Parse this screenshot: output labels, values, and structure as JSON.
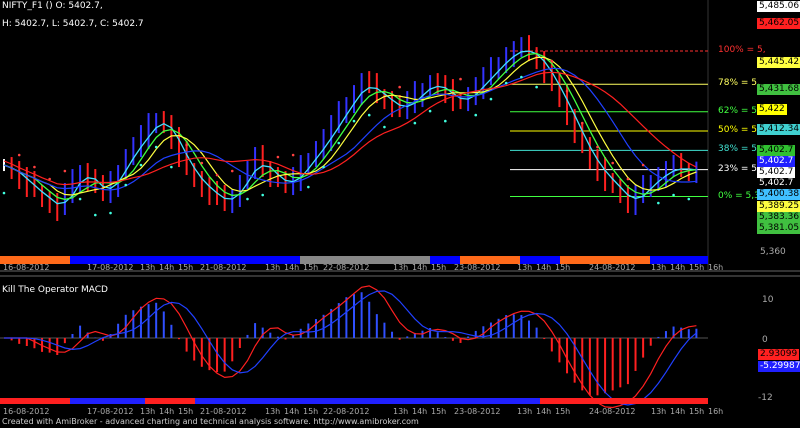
{
  "main_title": "NIFTY_F1 () O: 5402.7,",
  "main_ohlc": "H: 5402.7, L: 5402.7, C: 5402.7",
  "macd_title": "Kill The Operator MACD",
  "footer": "Created with AmiBroker - advanced charting and technical analysis software. http://www.amibroker.com",
  "colors": {
    "background": "#000000",
    "up_bar": "#3333ff",
    "down_bar": "#ff2020",
    "neutral_bar": "#ffffff",
    "ribbon_up": "#0000ff",
    "ribbon_down": "#ff6a1a",
    "ribbon_neutral": "#888888"
  },
  "fib_levels": [
    {
      "text": "100% = 5,",
      "price": 5462.05,
      "color": "#ff3030"
    },
    {
      "text": "78% = 5,",
      "price": 5445.42,
      "color": "#ffff60"
    },
    {
      "text": "62% = 5,",
      "price": 5431.68,
      "color": "#40ff40"
    },
    {
      "text": "50% = 5,",
      "price": 5422,
      "color": "#ffff00"
    },
    {
      "text": "38% = 5,",
      "price": 5412.34,
      "color": "#40e0d0"
    },
    {
      "text": "23% = 5,",
      "price": 5402.7,
      "color": "#ffffff"
    },
    {
      "text": "0% = 5,3",
      "price": 5389.25,
      "color": "#40ff40"
    }
  ],
  "price_labels": [
    {
      "text": "5,485.06",
      "bg": "#ffffff",
      "fg": "#000000"
    },
    {
      "text": "5,462.05",
      "bg": "#ff2020",
      "fg": "#000000"
    },
    {
      "text": "5,445.42",
      "bg": "#ffff40",
      "fg": "#000000"
    },
    {
      "text": "5,431.68",
      "bg": "#40c040",
      "fg": "#000000"
    },
    {
      "text": "5,422",
      "bg": "#ffff00",
      "fg": "#000000"
    },
    {
      "text": "5,412.34",
      "bg": "#40d0d0",
      "fg": "#000000"
    },
    {
      "text": "5,402.7",
      "bg": "#30c030",
      "fg": "#000000"
    },
    {
      "text": "5,402.7",
      "bg": "#2020ff",
      "fg": "#ffffff"
    },
    {
      "text": "5,402.7",
      "bg": "#ffffff",
      "fg": "#000000"
    },
    {
      "text": "5,402.7",
      "bg": "#000000",
      "fg": "#ffffff"
    },
    {
      "text": "5,400.38",
      "bg": "#40c0ff",
      "fg": "#000000"
    },
    {
      "text": "5,389.25",
      "bg": "#ffff40",
      "fg": "#000000"
    },
    {
      "text": "5,383.36",
      "bg": "#40c040",
      "fg": "#000000"
    },
    {
      "text": "5,381.05",
      "bg": "#40c040",
      "fg": "#000000"
    }
  ],
  "main_axis_ticks": [
    "5,360"
  ],
  "macd_labels": [
    {
      "text": "2.93099",
      "bg": "#ff2020",
      "fg": "#000000"
    },
    {
      "text": "-5.29987",
      "bg": "#2020ff",
      "fg": "#ffffff"
    }
  ],
  "macd_axis_ticks": [
    "10",
    "0",
    "-12"
  ],
  "time_labels": [
    "16-08-2012",
    "17-08-2012",
    "13h",
    "14h",
    "15h",
    "21-08-2012",
    "13h",
    "14h",
    "15h",
    "22-08-2012",
    "13h",
    "14h",
    "15h",
    "23-08-2012",
    "13h",
    "14h",
    "15h",
    "24-08-2012",
    "13h",
    "14h",
    "15h",
    "16h"
  ],
  "chart_data": {
    "type": "candlestick",
    "title": "NIFTY_F1",
    "ylim": [
      5360,
      5485.06
    ],
    "close_series": [
      5405,
      5402,
      5398,
      5395,
      5392,
      5388,
      5386,
      5383,
      5390,
      5396,
      5402,
      5398,
      5394,
      5391,
      5395,
      5402,
      5409,
      5414,
      5419,
      5424,
      5428,
      5425,
      5418,
      5410,
      5403,
      5398,
      5394,
      5391,
      5388,
      5386,
      5390,
      5396,
      5402,
      5408,
      5404,
      5400,
      5397,
      5395,
      5398,
      5403,
      5408,
      5413,
      5418,
      5424,
      5430,
      5436,
      5441,
      5446,
      5444,
      5440,
      5438,
      5435,
      5432,
      5436,
      5440,
      5443,
      5446,
      5444,
      5441,
      5438,
      5436,
      5440,
      5444,
      5448,
      5452,
      5456,
      5460,
      5462,
      5463,
      5461,
      5458,
      5452,
      5445,
      5438,
      5430,
      5422,
      5414,
      5407,
      5402,
      5398,
      5394,
      5390,
      5386,
      5389,
      5393,
      5397,
      5400,
      5402,
      5404,
      5403,
      5402,
      5402.7
    ],
    "macd": {
      "macd_line": 2.93099,
      "signal_line": -5.29987,
      "ylim": [
        -14,
        12
      ]
    }
  }
}
